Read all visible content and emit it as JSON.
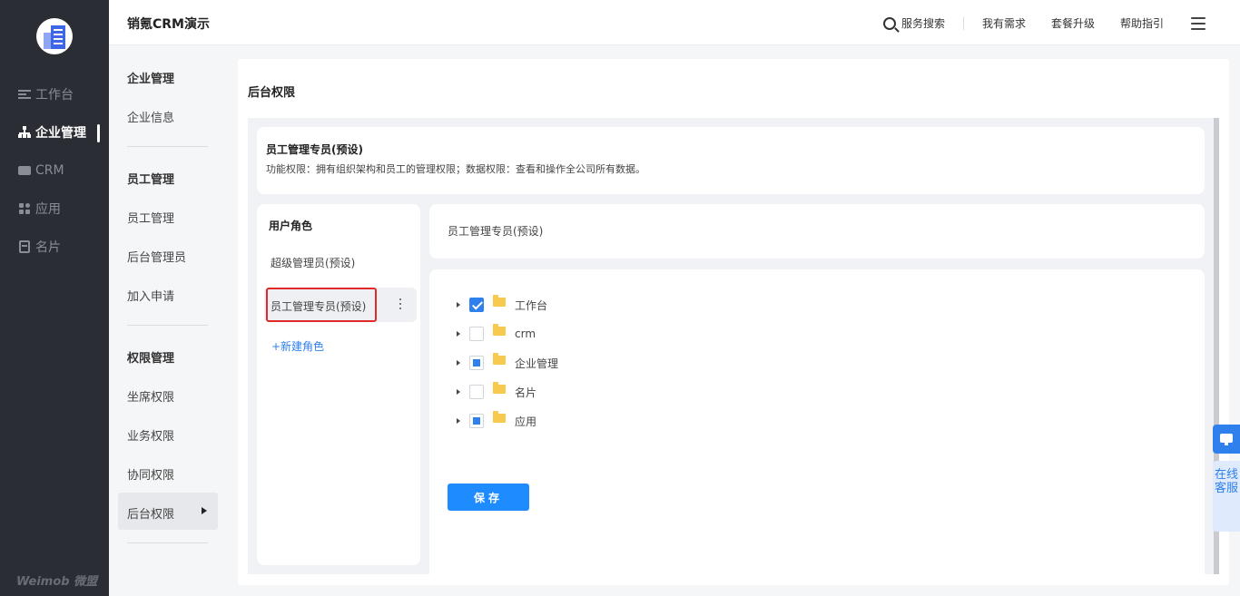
{
  "app": {
    "title": "销氪CRM演示",
    "brand": "Weimob 微盟"
  },
  "leftnav": {
    "items": [
      {
        "label": "工作台",
        "icon": "workbench-icon"
      },
      {
        "label": "企业管理",
        "icon": "org-icon",
        "active": true
      },
      {
        "label": "CRM",
        "icon": "crm-icon"
      },
      {
        "label": "应用",
        "icon": "apps-icon"
      },
      {
        "label": "名片",
        "icon": "card-icon"
      }
    ]
  },
  "topbar": {
    "search_label": "服务搜索",
    "needs_label": "我有需求",
    "upgrade_label": "套餐升级",
    "help_label": "帮助指引"
  },
  "subnav": {
    "group1": "企业管理",
    "group1_items": [
      "企业信息"
    ],
    "group2": "员工管理",
    "group2_items": [
      "员工管理",
      "后台管理员",
      "加入申请"
    ],
    "group3": "权限管理",
    "group3_items": [
      "坐席权限",
      "业务权限",
      "协同权限",
      "后台权限"
    ]
  },
  "main": {
    "title": "后台权限",
    "desc": {
      "title": "员工管理专员(预设)",
      "text": "功能权限：拥有组织架构和员工的管理权限；数据权限：查看和操作全公司所有数据。"
    },
    "roles": {
      "title": "用户角色",
      "items": [
        "超级管理员(预设)",
        "员工管理专员(预设)"
      ],
      "new_role": "+新建角色"
    },
    "selected_role_name": "员工管理专员(预设)",
    "tree": [
      {
        "label": "工作台",
        "state": "checked"
      },
      {
        "label": "crm",
        "state": "unchecked"
      },
      {
        "label": "企业管理",
        "state": "partial"
      },
      {
        "label": "名片",
        "state": "unchecked"
      },
      {
        "label": "应用",
        "state": "partial"
      }
    ],
    "save_label": "保存"
  },
  "float": {
    "service_label": "在线客服"
  },
  "colors": {
    "primary": "#1e8cff",
    "sidebar": "#2b2d35",
    "highlight": "#e02a2a",
    "folder": "#f7c94d"
  }
}
